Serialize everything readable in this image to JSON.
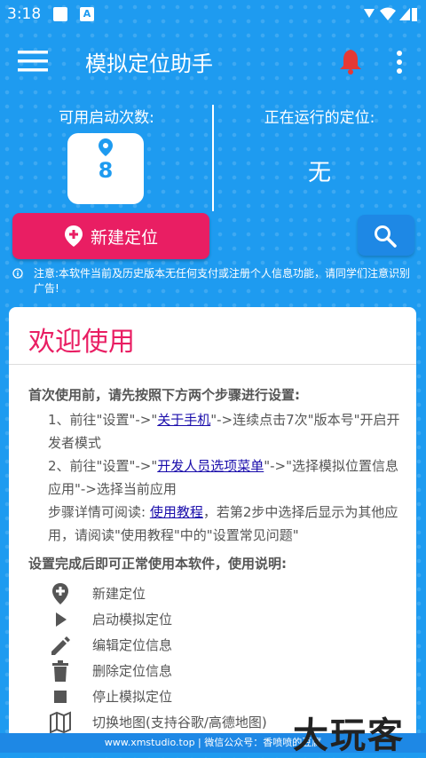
{
  "status": {
    "time": "3:18",
    "badge": "A"
  },
  "appbar": {
    "title": "模拟定位助手"
  },
  "quota": {
    "label": "可用启动次数:",
    "count": "8"
  },
  "running": {
    "label": "正在运行的定位:",
    "value": "无"
  },
  "actions": {
    "new_label": "新建定位"
  },
  "notice": {
    "text": "注意:本软件当前及历史版本无任何支付或注册个人信息功能，请同学们注意识别广告!"
  },
  "card": {
    "title": "欢迎使用",
    "intro": "首次使用前，请先按照下方两个步骤进行设置:",
    "step1": {
      "a": "1、前往\"设置\"->\"",
      "link": "关于手机",
      "b": "\"->连续点击7次\"版本号\"开启开发者模式"
    },
    "step2": {
      "a": "2、前往\"设置\"->\"",
      "link": "开发人员选项菜单",
      "b": "\"->\"选择模拟位置信息应用\"->选择当前应用"
    },
    "step3": {
      "a": "步骤详情可阅读: ",
      "link": "使用教程",
      "b": "，若第2步中选择后显示为其他应用，请阅读\"使用教程\"中的\"设置常见问题\""
    },
    "usage_title": "设置完成后即可正常使用本软件，使用说明:",
    "usage": [
      {
        "icon": "add-location-icon",
        "label": "新建定位"
      },
      {
        "icon": "play-icon",
        "label": "启动模拟定位"
      },
      {
        "icon": "pencil-icon",
        "label": "编辑定位信息"
      },
      {
        "icon": "trash-icon",
        "label": "删除定位信息"
      },
      {
        "icon": "stop-icon",
        "label": "停止模拟定位"
      },
      {
        "icon": "map-icon",
        "label": "切换地图(支持谷歌/高德地图)"
      }
    ]
  },
  "footer": {
    "text": "www.xmstudio.top | 微信公众号：香喷喷的豆腐"
  },
  "watermark": {
    "text": "大玩客"
  },
  "colors": {
    "primary": "#1e9bf0",
    "accent": "#e91e63",
    "link": "#1a0dab"
  }
}
